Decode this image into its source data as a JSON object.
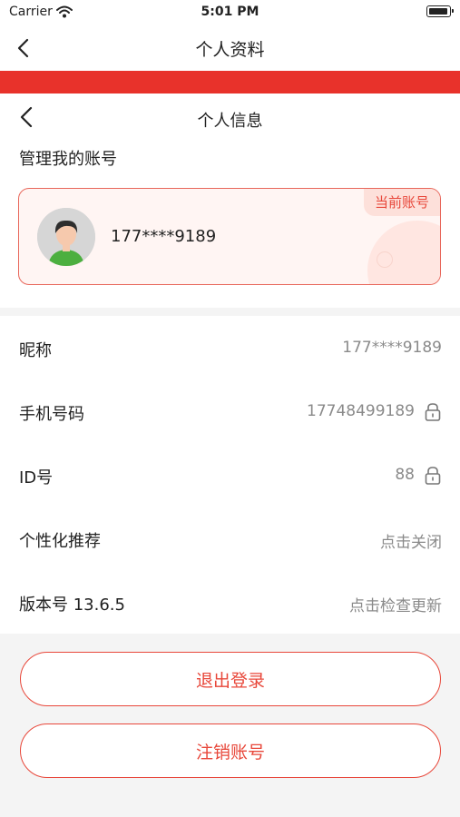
{
  "status_bar": {
    "carrier": "Carrier",
    "time": "5:01 PM"
  },
  "nav": {
    "title": "个人资料"
  },
  "sub_nav": {
    "title": "个人信息"
  },
  "account_section": {
    "title": "管理我的账号",
    "badge": "当前账号",
    "phone": "177****9189"
  },
  "settings": [
    {
      "label": "昵称",
      "value": "177****9189",
      "locked": false
    },
    {
      "label": "手机号码",
      "value": "17748499189",
      "locked": true
    },
    {
      "label": "ID号",
      "value": "88",
      "locked": true
    },
    {
      "label": "个性化推荐",
      "value": "点击关闭",
      "locked": false
    },
    {
      "label": "版本号 13.6.5",
      "value": "点击检查更新",
      "locked": false
    }
  ],
  "buttons": {
    "logout": "退出登录",
    "deregister": "注销账号"
  },
  "colors": {
    "accent": "#e8473a",
    "band": "#e8322b"
  }
}
